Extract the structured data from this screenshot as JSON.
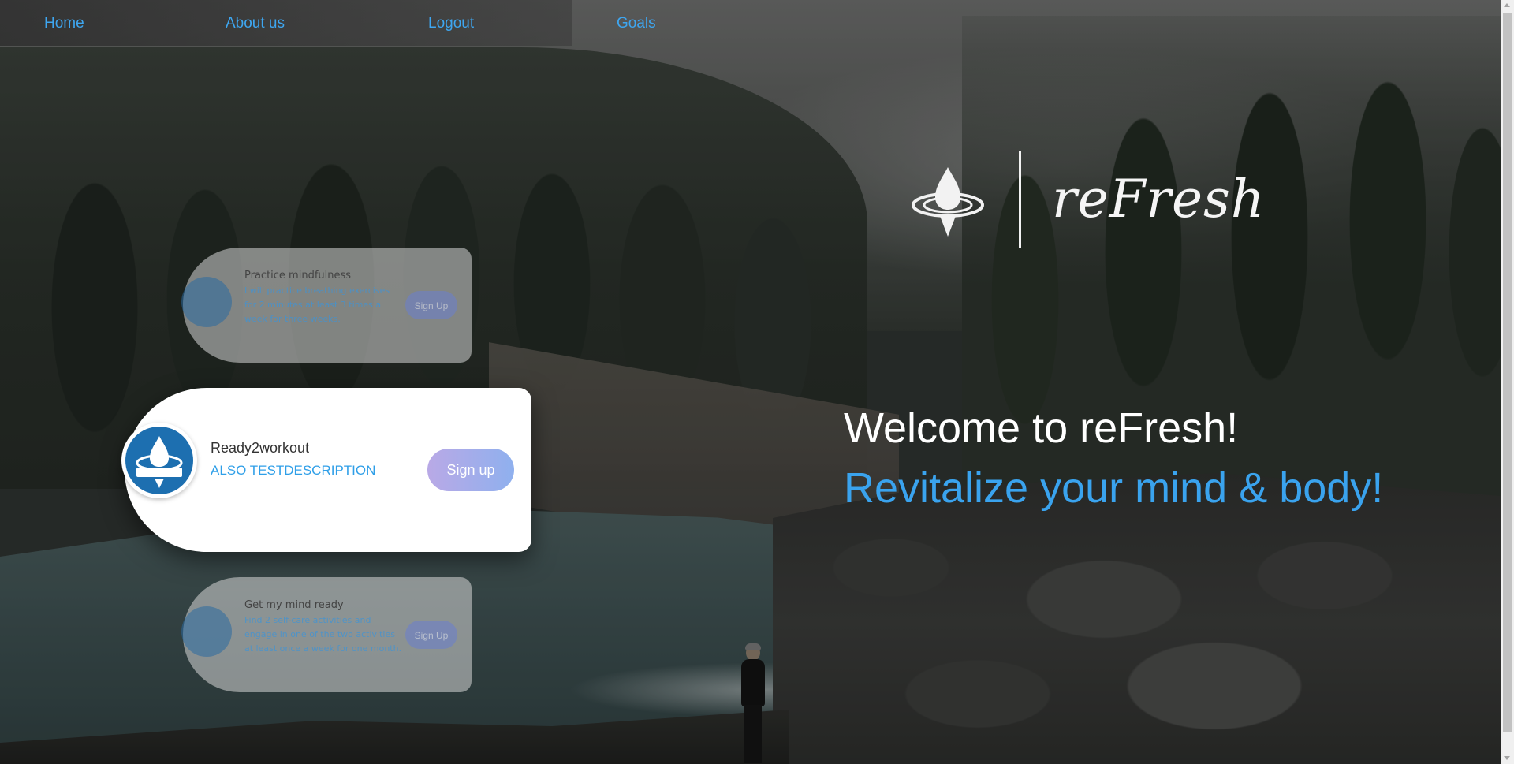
{
  "nav": {
    "items": [
      {
        "label": "Home"
      },
      {
        "label": "About us"
      },
      {
        "label": "Logout"
      },
      {
        "label": "Goals"
      }
    ]
  },
  "brand": {
    "name": "reFresh",
    "logo_icon": "water-drop-ripple-icon"
  },
  "hero": {
    "welcome": "Welcome to reFresh!",
    "tagline": "Revitalize your mind & body!"
  },
  "goals": [
    {
      "title": "Practice mindfulness",
      "description": "I will practice breathing exercises for 2 minutes at least 3 times a week for three weeks.",
      "button": "Sign Up"
    },
    {
      "title": "Ready2workout",
      "description": "ALSO TESTDESCRIPTION",
      "button": "Sign up"
    },
    {
      "title": "Get my mind ready",
      "description": "Find 2 self-care activities and engage in one of the two activities at least once a week for one month.",
      "button": "Sign Up"
    }
  ],
  "colors": {
    "accent": "#3aa3ee",
    "card_button_start": "#b9a9e6",
    "card_button_end": "#8fb0ee",
    "avatar_blue": "#1d6fb0"
  }
}
